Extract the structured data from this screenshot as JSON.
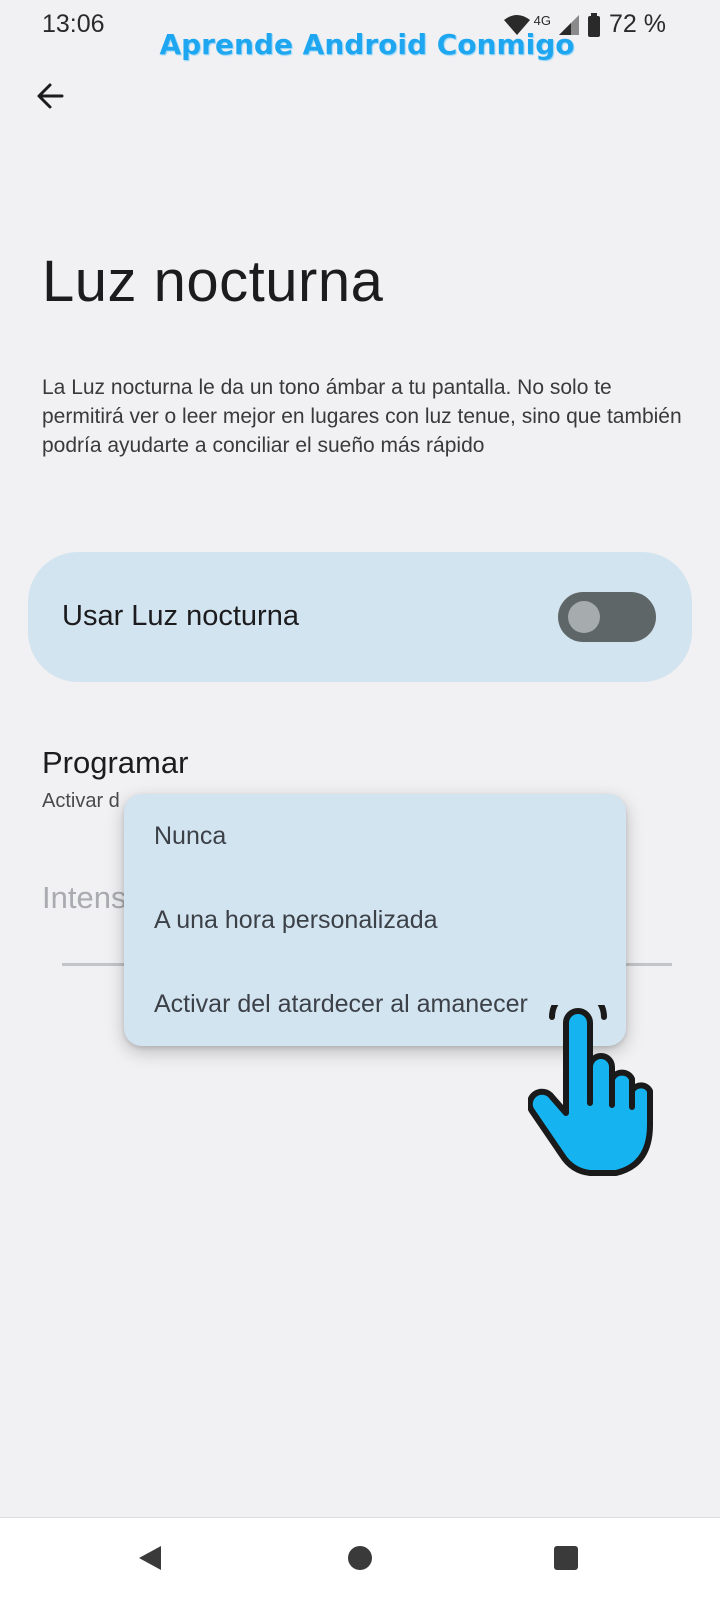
{
  "status_bar": {
    "time": "13:06",
    "network": "4G",
    "battery": "72 %",
    "icons": [
      "wifi-icon",
      "cellular-signal-icon",
      "battery-icon"
    ]
  },
  "watermark": "Aprende Android Conmigo",
  "header": {
    "back_icon": "arrow-back-icon"
  },
  "page": {
    "title": "Luz nocturna",
    "description": "La Luz nocturna le da un tono ámbar a tu pantalla. No solo te permitirá ver o leer mejor en lugares con luz tenue, sino que también podría ayudarte a conciliar el sueño más rápido"
  },
  "main_toggle": {
    "label": "Usar Luz nocturna",
    "checked": false
  },
  "schedule": {
    "title": "Programar",
    "subtitle": "Activar del atardecer al amanecer",
    "subtitle_visible": "Activar d"
  },
  "intensity": {
    "label_visible": "Intens"
  },
  "schedule_menu": {
    "options": [
      "Nunca",
      "A una hora personalizada",
      "Activar del atardecer al amanecer"
    ]
  },
  "nav_bar": {
    "icons": [
      "nav-back-icon",
      "nav-home-icon",
      "nav-recents-icon"
    ]
  },
  "colors": {
    "background": "#f1f1f3",
    "card": "#d3e4f1",
    "watermark": "#1ea7f0",
    "hand": "#15b4f0"
  }
}
